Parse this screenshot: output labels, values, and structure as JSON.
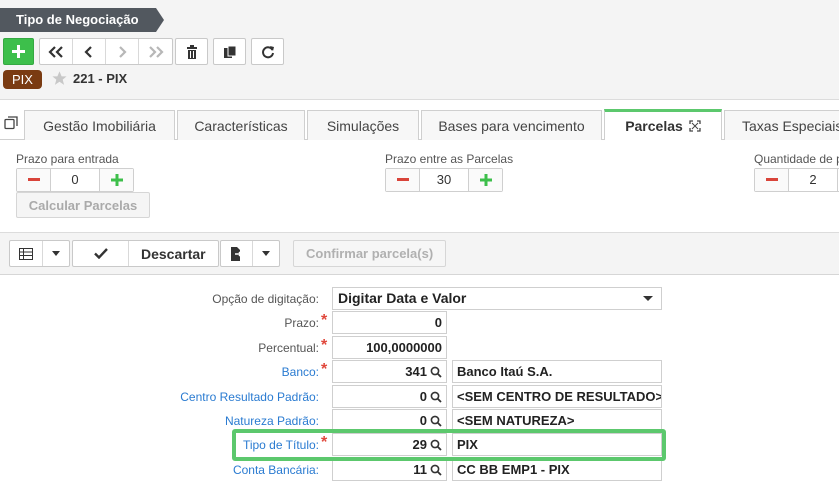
{
  "header": {
    "title": "Tipo de Negociação",
    "badge": "PIX",
    "record": "221 - PIX"
  },
  "toolbar": {
    "buttons": [
      "add-icon",
      "first-icon",
      "prev-icon",
      "next-icon",
      "last-icon",
      "delete-icon",
      "duplicate-icon",
      "refresh-icon"
    ]
  },
  "tabs": [
    {
      "label": "Gestão Imobiliária"
    },
    {
      "label": "Características"
    },
    {
      "label": "Simulações"
    },
    {
      "label": "Bases para vencimento"
    },
    {
      "label": "Parcelas"
    },
    {
      "label": "Taxas Especiais"
    }
  ],
  "parcelas": {
    "prazo_entrada": {
      "label": "Prazo para entrada",
      "value": "0"
    },
    "prazo_parcelas": {
      "label": "Prazo entre as Parcelas",
      "value": "30"
    },
    "quantidade": {
      "label": "Quantidade de p",
      "value": "2"
    },
    "calc_button": "Calcular Parcelas"
  },
  "grid_toolbar": {
    "discard": "Descartar",
    "confirm": "Confirmar parcela(s)"
  },
  "form": {
    "opcao": {
      "label": "Opção de digitação:",
      "value": "Digitar Data e Valor"
    },
    "prazo": {
      "label": "Prazo:",
      "value": "0"
    },
    "percentual": {
      "label": "Percentual:",
      "value": "100,0000000"
    },
    "banco": {
      "label": "Banco:",
      "code": "341",
      "desc": "Banco Itaú S.A."
    },
    "centro": {
      "label": "Centro Resultado Padrão:",
      "code": "0",
      "desc": "<SEM CENTRO DE RESULTADO>"
    },
    "natureza": {
      "label": "Natureza Padrão:",
      "code": "0",
      "desc": "<SEM NATUREZA>"
    },
    "tipo_titulo": {
      "label": "Tipo de Título:",
      "code": "29",
      "desc": "PIX"
    },
    "conta": {
      "label": "Conta Bancária:",
      "code": "11",
      "desc": "CC BB EMP1 - PIX"
    }
  },
  "colors": {
    "accent_green": "#5cc86d",
    "add_green": "#3dbf4b",
    "badge_brown": "#7a3b12",
    "link_blue": "#2a7bd1",
    "required_red": "#e0483c"
  }
}
